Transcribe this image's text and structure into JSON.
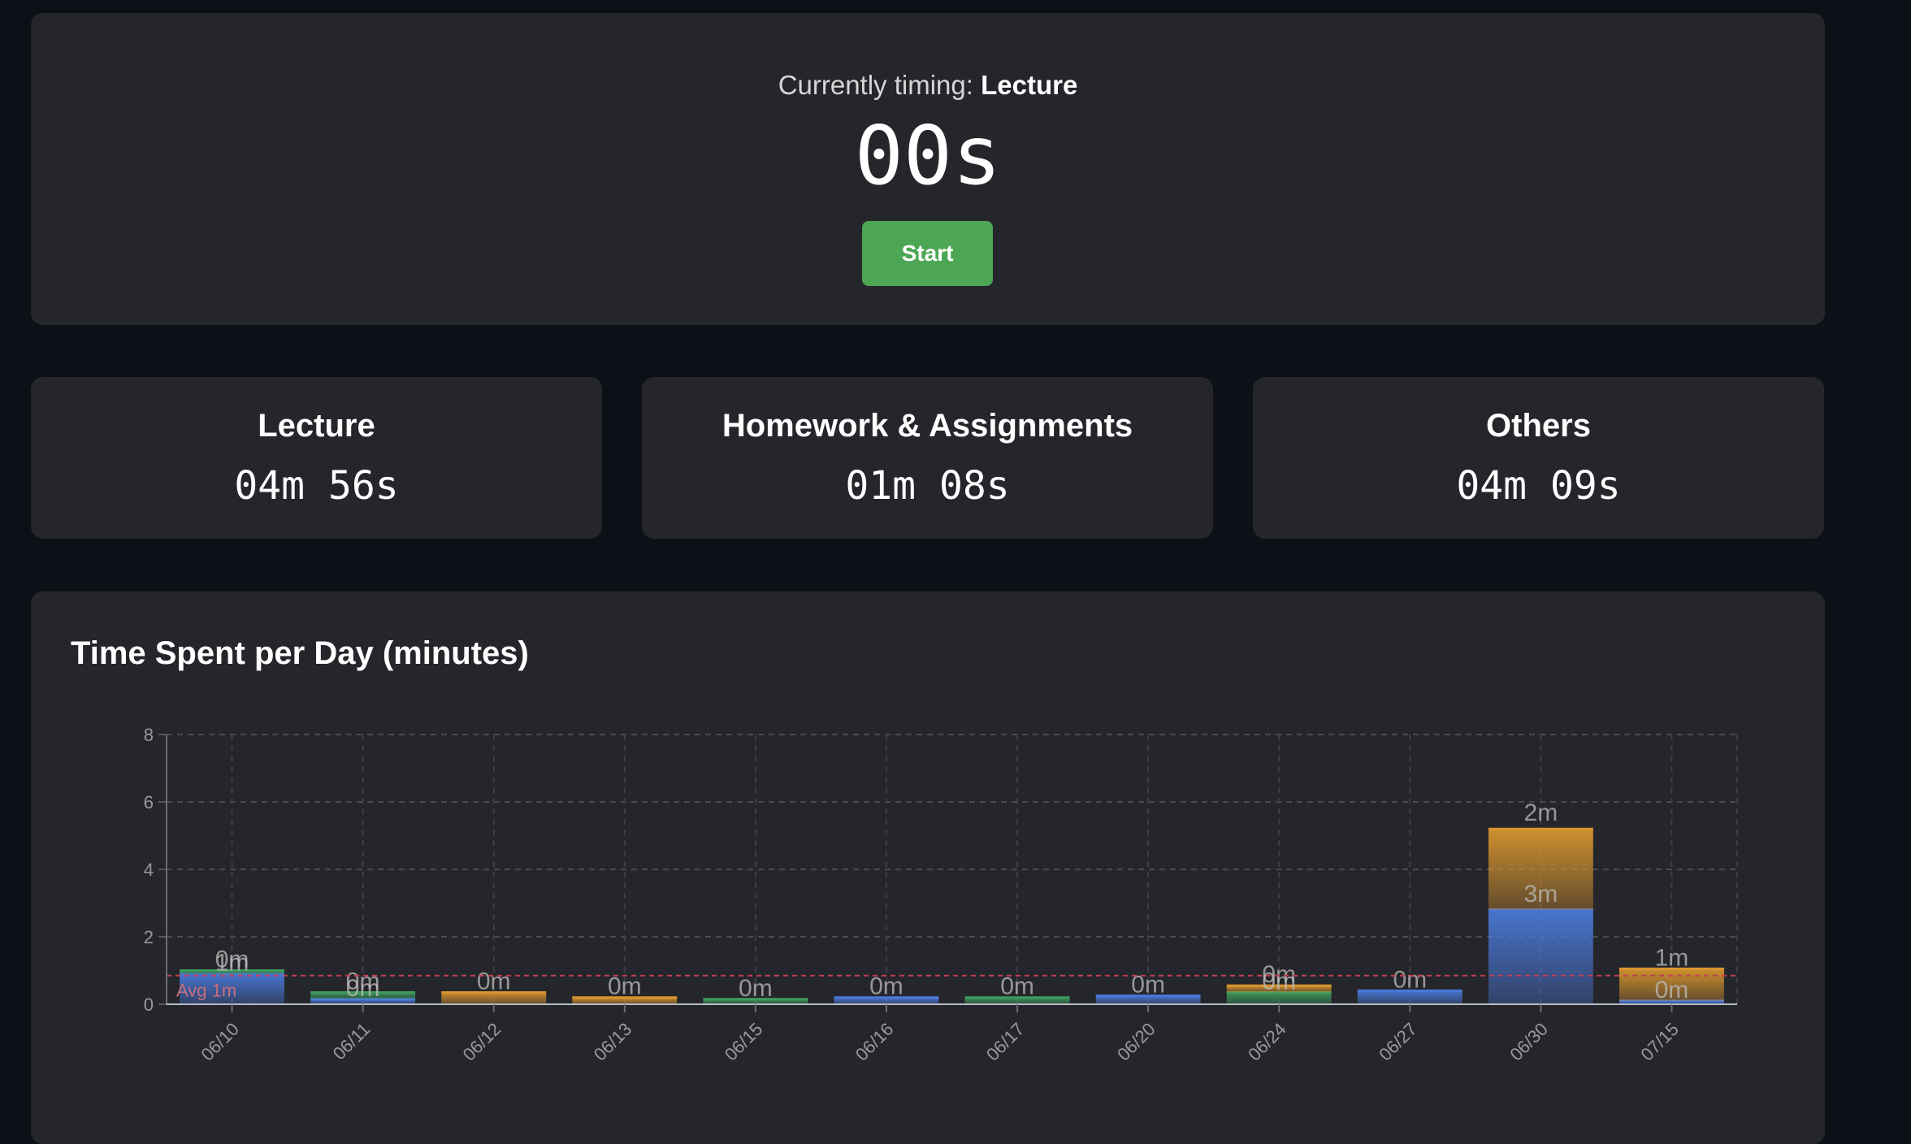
{
  "timer": {
    "status_prefix": "Currently timing:",
    "current_category": "Lecture",
    "display": "00s",
    "start_label": "Start"
  },
  "stats": [
    {
      "label": "Lecture",
      "value": "04m 56s"
    },
    {
      "label": "Homework & Assignments",
      "value": "01m 08s"
    },
    {
      "label": "Others",
      "value": "04m 09s"
    }
  ],
  "colors": {
    "background": "#0d1117",
    "panel": "#25262b",
    "start_button": "#4ca654",
    "lecture": "#4a78d8",
    "homework": "#3f9b5e",
    "others": "#d8952f",
    "average_line": "#c0404f"
  },
  "chart_data": {
    "type": "bar",
    "stacked": true,
    "title": "Time Spent per Day (minutes)",
    "xlabel": "",
    "ylabel": "",
    "ylim": [
      0,
      8
    ],
    "yticks": [
      0,
      2,
      4,
      6,
      8
    ],
    "grid": true,
    "categories": [
      "06/10",
      "06/11",
      "06/12",
      "06/13",
      "06/15",
      "06/16",
      "06/17",
      "06/20",
      "06/24",
      "06/27",
      "06/30",
      "07/15"
    ],
    "series": [
      {
        "key": "lecture",
        "values": [
          0.9,
          0.15,
          0,
          0,
          0,
          0.2,
          0,
          0.25,
          0,
          0.4,
          2.8,
          0.1
        ]
      },
      {
        "key": "homework",
        "values": [
          0.1,
          0.2,
          0,
          0,
          0.15,
          0,
          0.2,
          0,
          0.35,
          0,
          0,
          0
        ]
      },
      {
        "key": "others",
        "values": [
          0,
          0,
          0.35,
          0.2,
          0,
          0,
          0,
          0,
          0.2,
          0,
          2.4,
          0.95
        ]
      }
    ],
    "data_labels": [
      [
        {
          "text": "1m",
          "series": 0
        },
        {
          "text": "0m",
          "series": 1
        }
      ],
      [
        {
          "text": "0m",
          "series": 0
        },
        {
          "text": "0m",
          "series": 1
        }
      ],
      [
        {
          "text": "0m",
          "series": 2
        }
      ],
      [
        {
          "text": "0m",
          "series": 2
        }
      ],
      [
        {
          "text": "0m",
          "series": 1
        }
      ],
      [
        {
          "text": "0m",
          "series": 0
        }
      ],
      [
        {
          "text": "0m",
          "series": 1
        }
      ],
      [
        {
          "text": "0m",
          "series": 0
        }
      ],
      [
        {
          "text": "0m",
          "series": 1
        },
        {
          "text": "0m",
          "series": 2
        }
      ],
      [
        {
          "text": "0m",
          "series": 0
        }
      ],
      [
        {
          "text": "3m",
          "series": 0
        },
        {
          "text": "2m",
          "series": 2
        }
      ],
      [
        {
          "text": "0m",
          "series": 0
        },
        {
          "text": "1m",
          "series": 2
        }
      ]
    ],
    "average": {
      "value": 0.85,
      "label": "Avg 1m"
    }
  }
}
